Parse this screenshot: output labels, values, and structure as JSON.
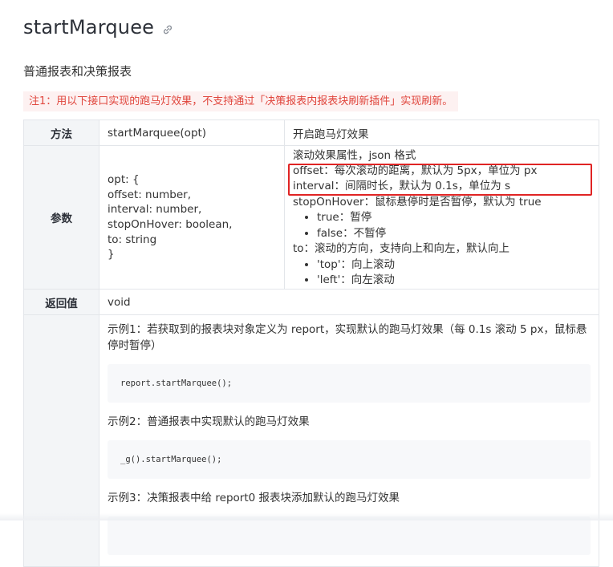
{
  "page": {
    "title": "startMarquee",
    "subtitle": "普通报表和决策报表",
    "note": "注1：用以下接口实现的跑马灯效果，不支持通过「决策报表内报表块刷新插件」实现刷新。"
  },
  "table": {
    "method": {
      "key": "方法",
      "value": "startMarquee(opt)",
      "desc": "开启跑马灯效果"
    },
    "params": {
      "key": "参数",
      "code": [
        "opt: {",
        "offset: number,",
        "interval: number,",
        "stopOnHover: boolean,",
        "to: string",
        "}"
      ],
      "desc_line1": "滚动效果属性，json 格式",
      "desc_offset": "offset：每次滚动的距离，默认为 5px，单位为 px",
      "desc_interval": "interval：间隔时长，默认为 0.1s，单位为 s",
      "desc_stop": "stopOnHover：鼠标悬停时是否暂停，默认为 true",
      "stop_items": [
        "true：暂停",
        "false：不暂停"
      ],
      "desc_to": "to：滚动的方向，支持向上和向左，默认向上",
      "to_items": [
        "'top'：向上滚动",
        "'left'：向左滚动"
      ]
    },
    "return": {
      "key": "返回值",
      "value": "void"
    },
    "examples": [
      {
        "text": "示例1：若获取到的报表块对象定义为 report，实现默认的跑马灯效果（每 0.1s 滚动 5 px，鼠标悬停时暂停）",
        "code": "report.startMarquee();"
      },
      {
        "text": "示例2：普通报表中实现默认的跑马灯效果",
        "code": "_g().startMarquee();"
      },
      {
        "text": "示例3：决策报表中给 report0 报表块添加默认的跑马灯效果"
      }
    ]
  },
  "icons": {
    "title_link": "link-icon"
  },
  "colors": {
    "note_text": "#e0453c",
    "note_bg": "#fdf1f1",
    "highlight_border": "#e02424",
    "key_bg": "#f3f5f7"
  }
}
